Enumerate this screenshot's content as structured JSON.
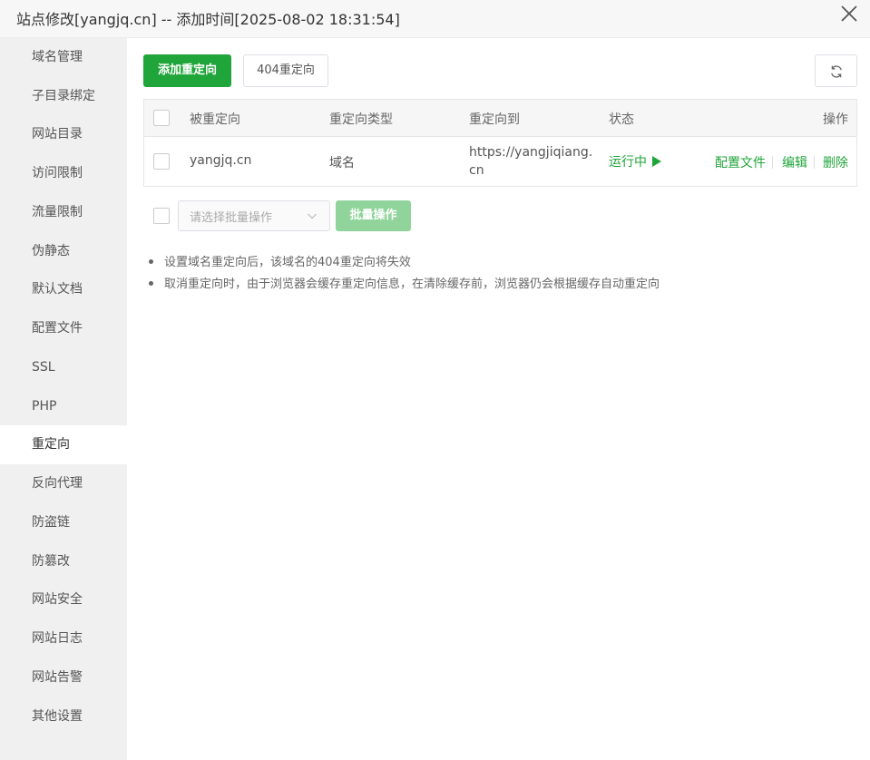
{
  "window": {
    "title": "站点修改[yangjq.cn] -- 添加时间[2025-08-02 18:31:54]"
  },
  "sidebar": {
    "items": [
      {
        "label": "域名管理"
      },
      {
        "label": "子目录绑定"
      },
      {
        "label": "网站目录"
      },
      {
        "label": "访问限制"
      },
      {
        "label": "流量限制"
      },
      {
        "label": "伪静态"
      },
      {
        "label": "默认文档"
      },
      {
        "label": "配置文件"
      },
      {
        "label": "SSL"
      },
      {
        "label": "PHP"
      },
      {
        "label": "重定向",
        "active": true
      },
      {
        "label": "反向代理"
      },
      {
        "label": "防盗链"
      },
      {
        "label": "防篡改"
      },
      {
        "label": "网站安全"
      },
      {
        "label": "网站日志"
      },
      {
        "label": "网站告警"
      },
      {
        "label": "其他设置"
      }
    ]
  },
  "toolbar": {
    "add_label": "添加重定向",
    "r404_label": "404重定向",
    "refresh_icon": "refresh-icon"
  },
  "table": {
    "headers": [
      "被重定向",
      "重定向类型",
      "重定向到",
      "状态",
      "操作"
    ],
    "rows": [
      {
        "source": "yangjq.cn",
        "type": "域名",
        "target": "https://yangjiqiang.cn",
        "status": "运行中",
        "actions": [
          "配置文件",
          "编辑",
          "删除"
        ]
      }
    ]
  },
  "batch": {
    "placeholder": "请选择批量操作",
    "button": "批量操作"
  },
  "tips": [
    "设置域名重定向后，该域名的404重定向将失效",
    "取消重定向时，由于浏览器会缓存重定向信息，在清除缓存前，浏览器仍会根据缓存自动重定向"
  ],
  "colors": {
    "accent": "#20a53a",
    "accent_disabled": "#90d49c",
    "sidebar_bg": "#f0f0f0"
  }
}
